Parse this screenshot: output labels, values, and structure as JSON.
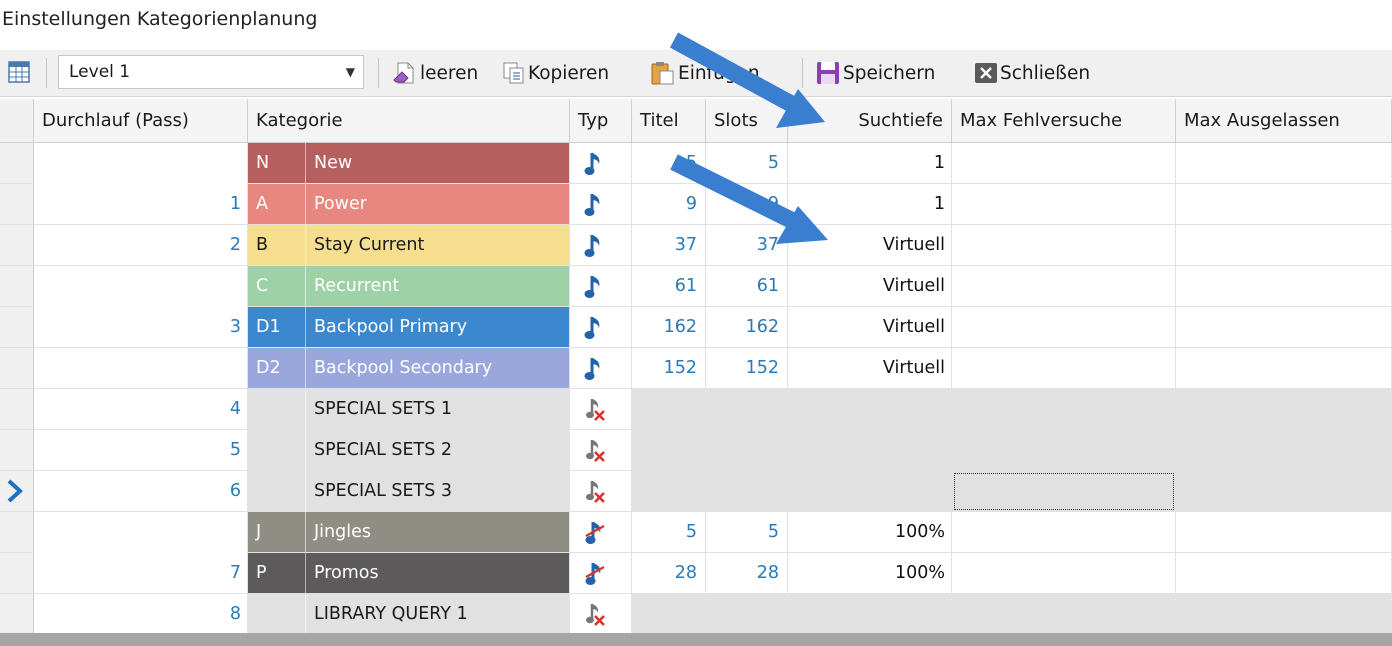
{
  "window": {
    "title": "Einstellungen Kategorienplanung"
  },
  "toolbar": {
    "level": "Level 1",
    "clear_label": "leeren",
    "copy_label": "Kopieren",
    "paste_label": "Einfügen",
    "save_label": "Speichern",
    "close_label": "Schließen"
  },
  "table": {
    "headers": {
      "pass": "Durchlauf (Pass)",
      "category": "Kategorie",
      "type": "Typ",
      "titles": "Titel",
      "slots": "Slots",
      "depth": "Suchtiefe",
      "max_failed": "Max Fehlversuche",
      "max_skipped": "Max Ausgelassen"
    },
    "rows": [
      {
        "pass": "",
        "code": "N",
        "name": "New",
        "type": "music",
        "titles": "5",
        "slots": "5",
        "depth": "1",
        "code_bg": "#b65f5f",
        "name_bg": "#b65f5f",
        "fg": "#ffffff"
      },
      {
        "pass": "1",
        "code": "A",
        "name": "Power",
        "type": "music",
        "titles": "9",
        "slots": "9",
        "depth": "1",
        "code_bg": "#e8877f",
        "name_bg": "#e8877f",
        "fg": "#ffffff"
      },
      {
        "pass": "2",
        "code": "B",
        "name": "Stay Current",
        "type": "music",
        "titles": "37",
        "slots": "37",
        "depth": "Virtuell",
        "code_bg": "#f5df8e",
        "name_bg": "#f5df8e",
        "fg": "#1a1a1a"
      },
      {
        "pass": "",
        "code": "C",
        "name": "Recurrent",
        "type": "music",
        "titles": "61",
        "slots": "61",
        "depth": "Virtuell",
        "code_bg": "#9ed2a6",
        "name_bg": "#9ed2a6",
        "fg": "#ffffff"
      },
      {
        "pass": "3",
        "code": "D1",
        "name": "Backpool Primary",
        "type": "music",
        "titles": "162",
        "slots": "162",
        "depth": "Virtuell",
        "code_bg": "#3b88cf",
        "name_bg": "#3b88cf",
        "fg": "#ffffff"
      },
      {
        "pass": "",
        "code": "D2",
        "name": "Backpool Secondary",
        "type": "music",
        "titles": "152",
        "slots": "152",
        "depth": "Virtuell",
        "code_bg": "#9aa7dc",
        "name_bg": "#9aa7dc",
        "fg": "#ffffff"
      },
      {
        "pass": "4",
        "code": "",
        "name": "SPECIAL SETS 1",
        "type": "empty",
        "titles": "",
        "slots": "",
        "depth": "",
        "code_bg": "#e1e1e1",
        "name_bg": "#e1e1e1",
        "fg": "#1a1a1a"
      },
      {
        "pass": "5",
        "code": "",
        "name": "SPECIAL SETS 2",
        "type": "empty",
        "titles": "",
        "slots": "",
        "depth": "",
        "code_bg": "#e1e1e1",
        "name_bg": "#e1e1e1",
        "fg": "#1a1a1a"
      },
      {
        "pass": "6",
        "code": "",
        "name": "SPECIAL SETS 3",
        "type": "empty",
        "titles": "",
        "slots": "",
        "depth": "",
        "code_bg": "#e1e1e1",
        "name_bg": "#e1e1e1",
        "fg": "#1a1a1a"
      },
      {
        "pass": "",
        "code": "J",
        "name": "Jingles",
        "type": "jingle",
        "titles": "5",
        "slots": "5",
        "depth": "100%",
        "code_bg": "#8f8e84",
        "name_bg": "#8f8e84",
        "fg": "#ffffff"
      },
      {
        "pass": "7",
        "code": "P",
        "name": "Promos",
        "type": "jingle",
        "titles": "28",
        "slots": "28",
        "depth": "100%",
        "code_bg": "#5c5a5b",
        "name_bg": "#5c5a5b",
        "fg": "#ffffff"
      },
      {
        "pass": "8",
        "code": "",
        "name": "LIBRARY QUERY 1",
        "type": "empty",
        "titles": "",
        "slots": "",
        "depth": "",
        "code_bg": "#e1e1e1",
        "name_bg": "#e1e1e1",
        "fg": "#1a1a1a"
      }
    ]
  },
  "icons": {
    "music": "music-note-icon",
    "jingle": "jingle-icon",
    "empty": "no-music-icon",
    "current_row": "current-row-arrow-icon"
  },
  "colors": {
    "link_blue": "#2a7ab8",
    "annotation_arrow": "#3a7fcf",
    "disabled_row": "#e1e1e1"
  }
}
